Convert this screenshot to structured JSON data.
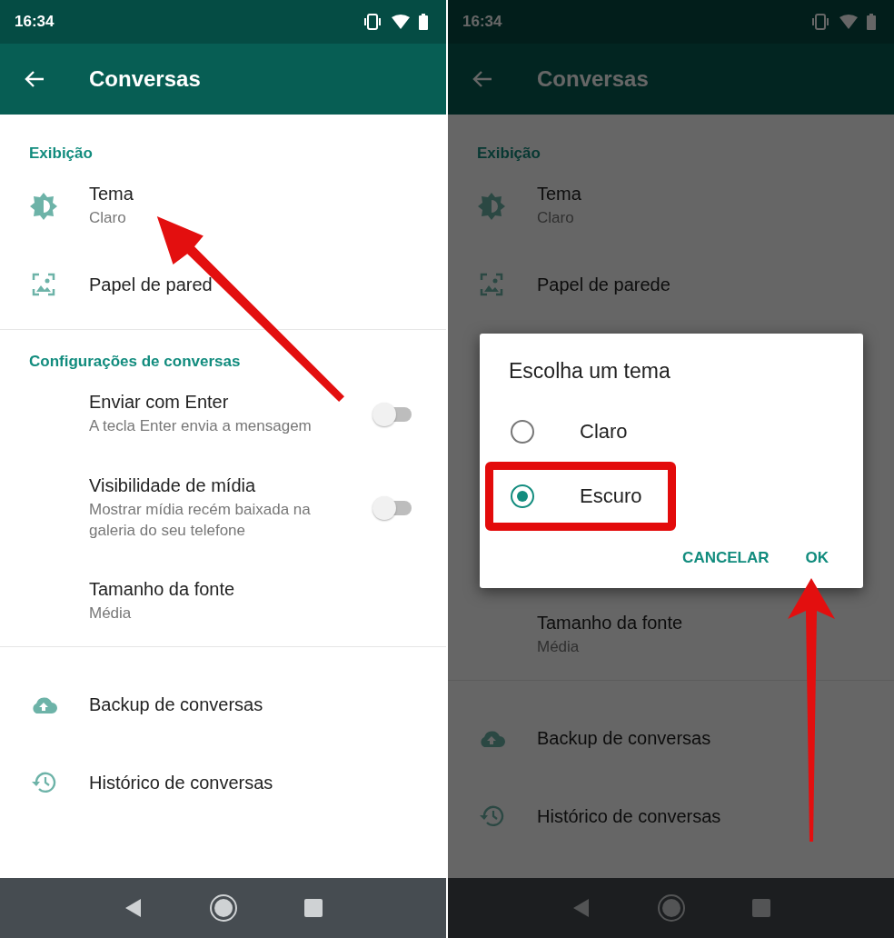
{
  "screens": [
    {
      "status_time": "16:34",
      "title": "Conversas",
      "dimmed": false,
      "pointer": {
        "kind": "diagonal"
      },
      "sections": [
        {
          "header": "Exibição",
          "items": [
            {
              "kind": "brightness",
              "title": "Tema",
              "subtitle": "Claro"
            },
            {
              "kind": "wallpaper",
              "title": "Papel de pared"
            }
          ]
        },
        {
          "header": "Configurações de conversas",
          "items": [
            {
              "kind": "toggle",
              "title": "Enviar com Enter",
              "subtitle": "A tecla Enter envia a mensagem",
              "on": false
            },
            {
              "kind": "toggle",
              "title": "Visibilidade de mídia",
              "subtitle": "Mostrar mídia recém baixada na galeria do seu telefone",
              "on": false
            },
            {
              "kind": "text",
              "title": "Tamanho da fonte",
              "subtitle": "Média"
            }
          ]
        },
        {
          "items": [
            {
              "kind": "cloud",
              "title": "Backup de conversas"
            },
            {
              "kind": "history",
              "title": "Histórico de conversas"
            }
          ]
        }
      ]
    },
    {
      "status_time": "16:34",
      "title": "Conversas",
      "dimmed": true,
      "pointer": {
        "kind": "vertical"
      },
      "sections": [
        {
          "header": "Exibição",
          "items": [
            {
              "kind": "brightness",
              "title": "Tema",
              "subtitle": "Claro"
            },
            {
              "kind": "wallpaper",
              "title": "Papel de parede"
            }
          ]
        },
        {
          "items": [
            {
              "kind": "text",
              "title": "Tamanho da fonte",
              "subtitle": "Média"
            }
          ]
        },
        {
          "items": [
            {
              "kind": "cloud",
              "title": "Backup de conversas"
            },
            {
              "kind": "history",
              "title": "Histórico de conversas"
            }
          ]
        }
      ],
      "dialog": {
        "title": "Escolha um tema",
        "options": [
          {
            "label": "Claro",
            "selected": false,
            "highlighted": false
          },
          {
            "label": "Escuro",
            "selected": true,
            "highlighted": true
          }
        ],
        "buttons": [
          "CANCELAR",
          "OK"
        ]
      }
    }
  ]
}
